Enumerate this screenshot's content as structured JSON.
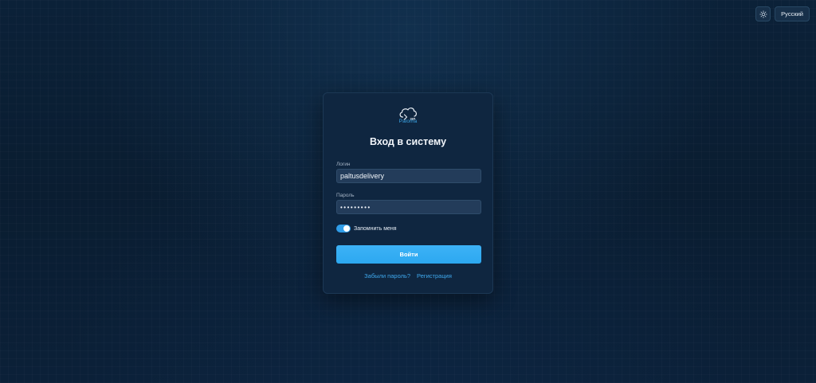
{
  "header": {
    "theme_toggle_icon": "sun-icon",
    "language_label": "Русский"
  },
  "login": {
    "logo_icon": "cloud-logo-icon",
    "logo_text": "Paloma",
    "logo_badge": "365",
    "title": "Вход в систему",
    "login_label": "Логин",
    "login_value": "paltusdelivery",
    "password_label": "Пароль",
    "password_value": "•••••••••",
    "remember_label": "Запомнить меня",
    "remember_checked": true,
    "submit_label": "Войти",
    "forgot_link": "Забыли пароль?",
    "register_link": "Регистрация"
  },
  "colors": {
    "accent": "#2ca8f0",
    "background": "#0a1d31",
    "card": "#0f2640",
    "input": "#233c5a"
  }
}
